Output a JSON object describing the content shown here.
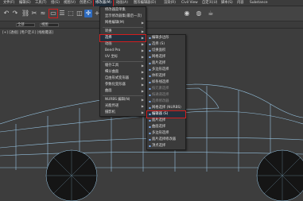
{
  "menubar": {
    "items": [
      "文件(F)",
      "编辑(E)",
      "工具(T)",
      "组(G)",
      "视图(V)",
      "创建(C)",
      "修改器(M)",
      "动画(A)",
      "图形编辑器(D)",
      "渲染(R)",
      "Civil View",
      "自定义(U)",
      "脚本(S)",
      "内容",
      "Substance"
    ]
  },
  "toolbar": {
    "buttons": [
      "undo-icon",
      "redo-icon",
      "link-icon",
      "unlink-icon",
      "bind-icon",
      "select-icon",
      "select-by-name-icon",
      "rect-select-icon",
      "window-crossing-icon",
      "move-icon",
      "plus-icon"
    ]
  },
  "ribbon": {
    "selection_label": "全部",
    "view_label": "视图",
    "scene_label": "[+] [透视] [用户定义] [线框覆盖]"
  },
  "modifiers_menu": {
    "items": [
      {
        "label": "修改器菜单集",
        "arrow": false
      },
      {
        "label": "显示修改器集(最后一次)",
        "arrow": false
      },
      {
        "label": "网格编辑(M)",
        "arrow": true
      },
      {
        "label": "转换",
        "arrow": true
      },
      {
        "label": "选择",
        "arrow": true,
        "selected": true
      },
      {
        "label": "动画",
        "arrow": true
      },
      {
        "label": "Bend Pro",
        "arrow": true
      },
      {
        "label": "UV 坐标",
        "arrow": true
      },
      {
        "label": "缓存工具",
        "arrow": true
      },
      {
        "label": "细分曲面",
        "arrow": true
      },
      {
        "label": "自由形式变形器",
        "arrow": true
      },
      {
        "label": "参数化变形器",
        "arrow": true
      },
      {
        "label": "曲面",
        "arrow": true
      },
      {
        "label": "NURBS 编辑(N)",
        "arrow": true
      },
      {
        "label": "光能传递",
        "arrow": true
      },
      {
        "label": "摄影机",
        "arrow": true
      }
    ]
  },
  "selection_submenu": {
    "items": [
      {
        "label": "编辑多边形",
        "dim": false
      },
      {
        "label": "选择 (S)",
        "dim": false
      },
      {
        "label": "切换面积",
        "dim": false
      },
      {
        "label": "网格选择",
        "dim": false
      },
      {
        "label": "面片选择",
        "dim": false
      },
      {
        "label": "多边形选择",
        "dim": false
      },
      {
        "label": "体积选择",
        "dim": false
      },
      {
        "label": "样条线选择",
        "dim": false
      },
      {
        "label": "按元素选择",
        "dim": true
      },
      {
        "label": "按通道选择",
        "dim": true
      },
      {
        "label": "选择修改器",
        "dim": true
      },
      {
        "label": "网格选择 (NURBS)",
        "dim": false
      },
      {
        "label": "编辑器 (S)",
        "dim": false,
        "selected": true
      },
      {
        "label": "面片选择",
        "dim": false
      },
      {
        "label": "曲面选择",
        "dim": false
      },
      {
        "label": "多边形选择",
        "dim": false
      },
      {
        "label": "面片选择修改器",
        "dim": false
      },
      {
        "label": "顶点选择",
        "dim": false
      }
    ]
  },
  "colors": {
    "wireframe": "#9fd0f0",
    "highlight": "#d21e1e",
    "menu_bg": "#3b3b3b"
  }
}
